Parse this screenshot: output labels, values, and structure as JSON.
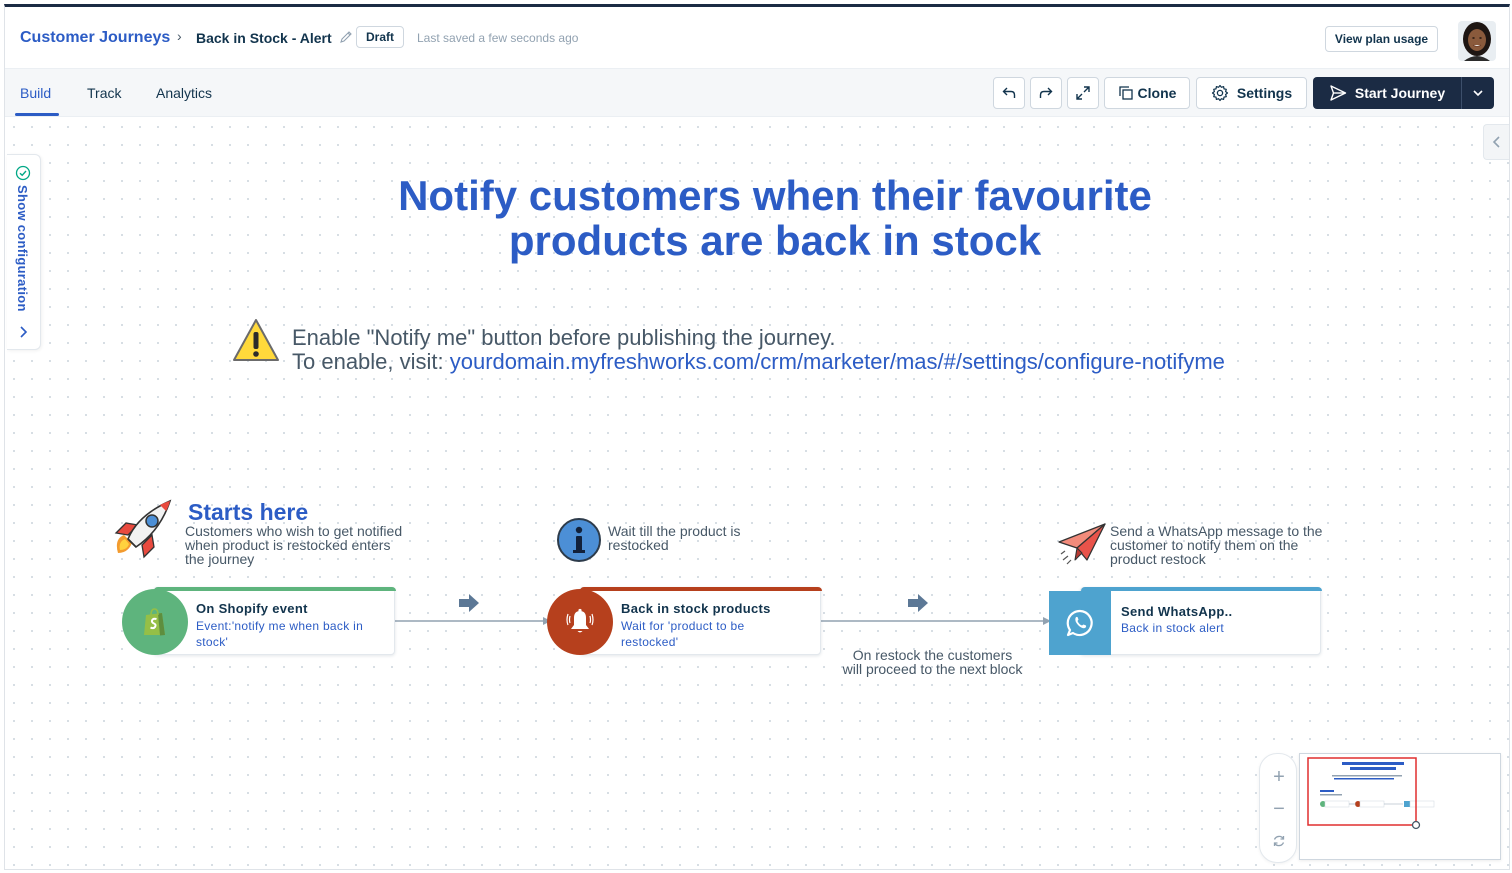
{
  "breadcrumb": {
    "root": "Customer Journeys",
    "separator": "›",
    "title": "Back in Stock - Alert"
  },
  "status": {
    "badge": "Draft",
    "saved": "Last saved a few seconds ago"
  },
  "header": {
    "plan_button": "View plan usage"
  },
  "tabs": [
    {
      "label": "Build",
      "active": true
    },
    {
      "label": "Track",
      "active": false
    },
    {
      "label": "Analytics",
      "active": false
    }
  ],
  "toolbar": {
    "clone_label": "Clone",
    "settings_label": "Settings",
    "start_label": "Start Journey"
  },
  "sidebar": {
    "config_label": "Show configuration"
  },
  "canvas": {
    "headline_1": "Notify customers when their favourite",
    "headline_2": "products are back in stock",
    "warning_line1": "Enable \"Notify me\" button before publishing the journey.",
    "warning_prefix": "To enable, visit: ",
    "warning_link": "yourdomain.myfreshworks.com/crm/marketer/mas/#/settings/configure-notifyme",
    "start_title": "Starts here",
    "start_desc_1": "Customers who wish to get notified",
    "start_desc_2": "when product is restocked enters",
    "start_desc_3": "the journey",
    "wait_desc_1": "Wait till the product is",
    "wait_desc_2": "restocked",
    "send_desc_1": "Send a WhatsApp message to the",
    "send_desc_2": "customer to notify them on the",
    "send_desc_3": "product restock",
    "connector_note_1": "On restock the customers",
    "connector_note_2": "will proceed to the next block"
  },
  "nodes": [
    {
      "title": "On Shopify event",
      "sub_1": "Event:'notify me when back in",
      "sub_2": "stock'",
      "icon": "shopify-icon",
      "color": "#5eb47d"
    },
    {
      "title": "Back in stock products",
      "sub_1": "Wait for 'product to be",
      "sub_2": "restocked'",
      "icon": "bell-icon",
      "color": "#b6401d"
    },
    {
      "title": "Send WhatsApp..",
      "sub_1": "Back in stock alert",
      "icon": "whatsapp-icon",
      "color": "#4ea3cf"
    }
  ],
  "zoom": {
    "in": "+",
    "out": "−"
  },
  "colors": {
    "accent": "#2c5cc5",
    "dark": "#1b2b44",
    "shopify": "#5eb47d",
    "wait": "#b6401d",
    "whatsapp": "#4ea3cf"
  }
}
